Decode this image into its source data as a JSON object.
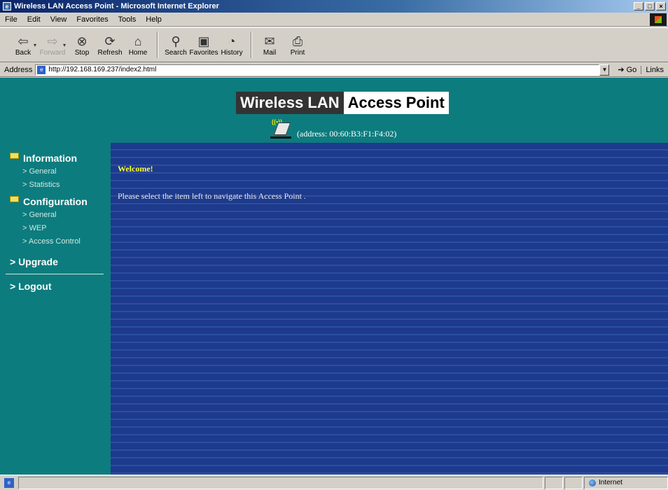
{
  "window": {
    "title": "Wireless LAN Access Point - Microsoft Internet Explorer"
  },
  "menu": [
    "File",
    "Edit",
    "View",
    "Favorites",
    "Tools",
    "Help"
  ],
  "toolbar": {
    "back": "Back",
    "forward": "Forward",
    "stop": "Stop",
    "refresh": "Refresh",
    "home": "Home",
    "search": "Search",
    "favorites": "Favorites",
    "history": "History",
    "mail": "Mail",
    "print": "Print"
  },
  "address": {
    "label": "Address",
    "url": "http://192.168.169.237/index2.html",
    "go": "Go",
    "links": "Links"
  },
  "page": {
    "banner_left": "Wireless LAN",
    "banner_right": "Access Point",
    "device_address": "(address: 00:60:B3:F1:F4:02)",
    "welcome": "Welcome!",
    "message": "Please select the item left to navigate this Access Point ."
  },
  "sidebar": {
    "information": "Information",
    "info_items": [
      "> General",
      "> Statistics"
    ],
    "configuration": "Configuration",
    "config_items": [
      "> General",
      "> WEP",
      "> Access Control"
    ],
    "upgrade": "> Upgrade",
    "logout": "> Logout"
  },
  "status": {
    "zone": "Internet"
  }
}
